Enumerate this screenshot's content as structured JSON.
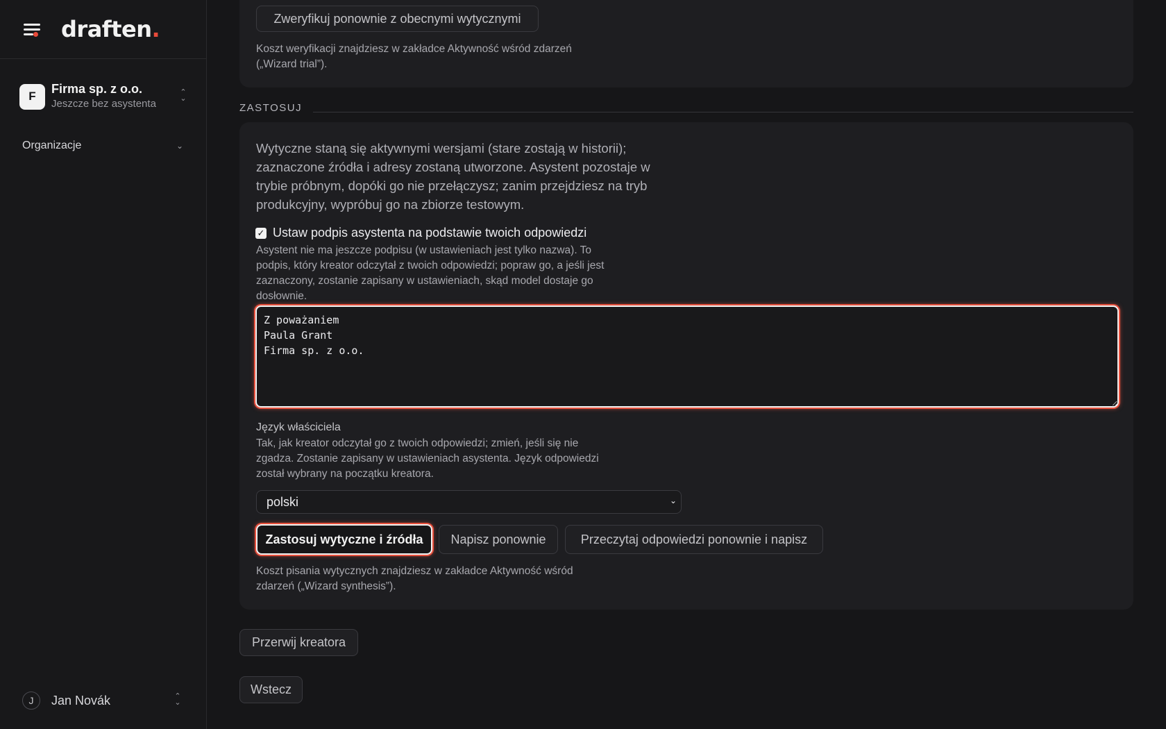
{
  "brand": {
    "logo_text": "draften",
    "logo_dot": "."
  },
  "org": {
    "initial": "F",
    "name": "Firma sp. z o.o.",
    "subtitle": "Jeszcze bez asystenta"
  },
  "nav": {
    "organizations_label": "Organizacje"
  },
  "user": {
    "initial": "J",
    "name": "Jan Novák"
  },
  "verify": {
    "button_label": "Zweryfikuj ponownie z obecnymi wytycznymi",
    "cost_note_line1": "Koszt weryfikacji znajdziesz w zakładce Aktywność wśród zdarzeń",
    "cost_note_line2": "(„Wizard trial”)."
  },
  "apply": {
    "section_label": "ZASTOSUJ",
    "description": "Wytyczne staną się aktywnymi wersjami (stare zostają w historii); zaznaczone źródła i adresy zostaną utworzone. Asystent pozostaje w trybie próbnym, dopóki go nie przełączysz; zanim przejdziesz na tryb produkcyjny, wypróbuj go na zbiorze testowym.",
    "signature_checkbox_label": "Ustaw podpis asystenta na podstawie twoich odpowiedzi",
    "signature_help": "Asystent nie ma jeszcze podpisu (w ustawieniach jest tylko nazwa). To podpis, który kreator odczytał z twoich odpowiedzi; popraw go, a jeśli jest zaznaczony, zostanie zapisany w ustawieniach, skąd model dostaje go dosłownie.",
    "signature_value": "Z poważaniem\nPaula Grant\nFirma sp. z o.o.",
    "owner_language_label": "Język właściciela",
    "owner_language_help": "Tak, jak kreator odczytał go z twoich odpowiedzi; zmień, jeśli się nie zgadza. Zostanie zapisany w ustawieniach asystenta. Język odpowiedzi został wybrany na początku kreatora.",
    "owner_language_value": "polski",
    "apply_button": "Zastosuj wytyczne i źródła",
    "rewrite_button": "Napisz ponownie",
    "reread_button": "Przeczytaj odpowiedzi ponownie i napisz",
    "cost_note": "Koszt pisania wytycznych znajdziesz w zakładce Aktywność wśród zdarzeń („Wizard synthesis”)."
  },
  "footer": {
    "abort_button": "Przerwij kreatora",
    "back_button": "Wstecz"
  },
  "colors": {
    "accent": "#e8503d",
    "background": "#161618",
    "card": "#1e1e21"
  }
}
